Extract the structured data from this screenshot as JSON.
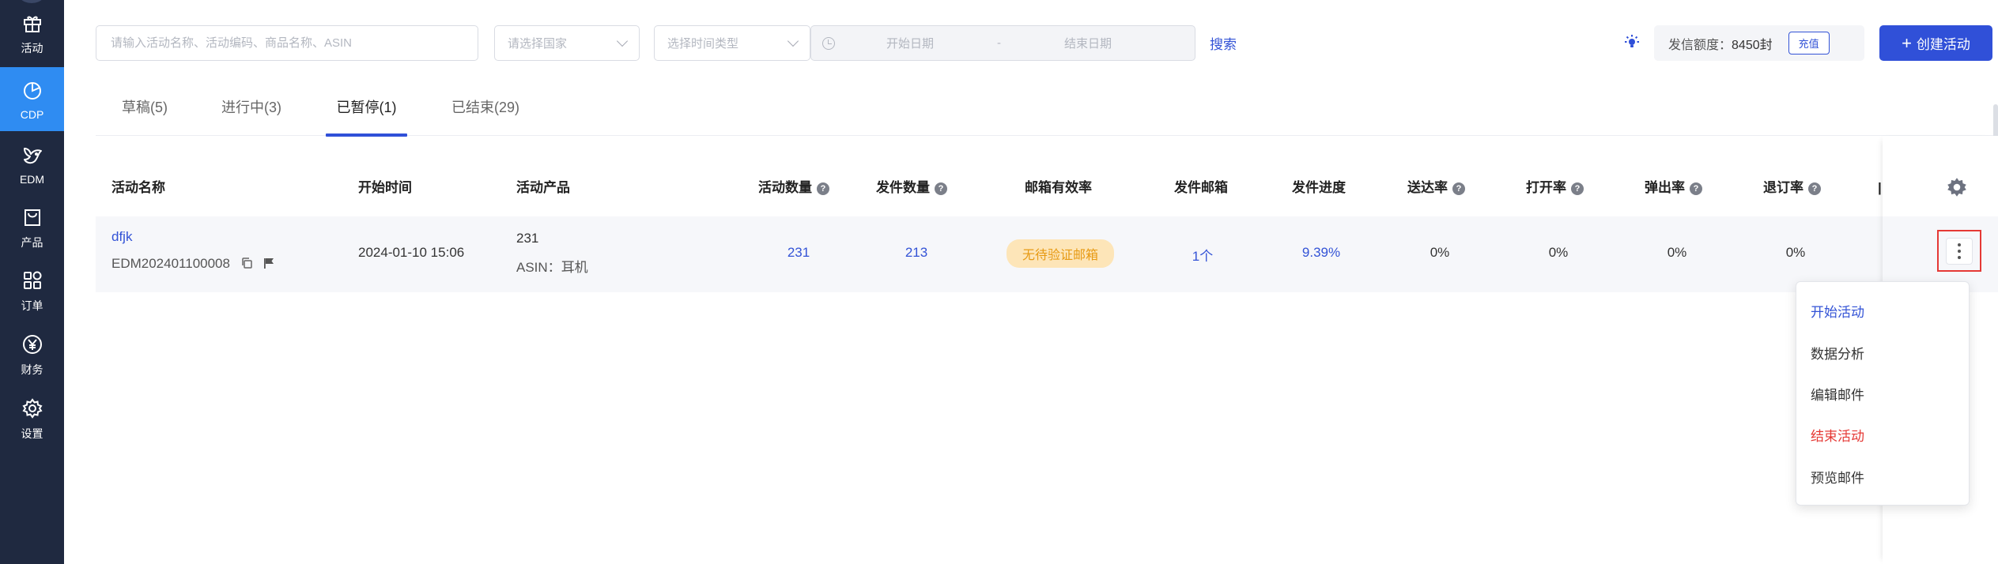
{
  "sidebar": {
    "items": [
      {
        "label": "活动",
        "icon": "gift-icon"
      },
      {
        "label": "CDP",
        "icon": "pie-chart-icon",
        "active": true
      },
      {
        "label": "EDM",
        "icon": "edm-bird-icon"
      },
      {
        "label": "产品",
        "icon": "shopping-bag-icon"
      },
      {
        "label": "订单",
        "icon": "grid-icon"
      },
      {
        "label": "财务",
        "icon": "yen-icon"
      },
      {
        "label": "设置",
        "icon": "gear-icon"
      }
    ]
  },
  "filters": {
    "search_placeholder": "请输入活动名称、活动编码、商品名称、ASIN",
    "country_placeholder": "请选择国家",
    "time_type_placeholder": "选择时间类型",
    "start_date_placeholder": "开始日期",
    "date_separator": "-",
    "end_date_placeholder": "结束日期",
    "search_label": "搜索"
  },
  "quota": {
    "label": "发信额度：",
    "value": "8450封",
    "recharge_label": "充值"
  },
  "create_button": {
    "icon": "+",
    "label": "创建活动"
  },
  "tabs": [
    {
      "label": "草稿(5)"
    },
    {
      "label": "进行中(3)"
    },
    {
      "label": "已暂停(1)",
      "active": true
    },
    {
      "label": "已结束(29)"
    }
  ],
  "table": {
    "columns": {
      "name": "活动名称",
      "start_time": "开始时间",
      "product": "活动产品",
      "activity_count": "活动数量",
      "send_count": "发件数量",
      "mailbox_validity": "邮箱有效率",
      "sender_mailbox": "发件邮箱",
      "send_progress": "发件进度",
      "delivery_rate": "送达率",
      "open_rate": "打开率",
      "bounce_rate": "弹出率",
      "unsubscribe_rate": "退订率",
      "help_glyph": "?"
    },
    "rows": [
      {
        "name": "dfjk",
        "code": "EDM202401100008",
        "start_time": "2024-01-10 15:06",
        "product_id": "231",
        "asin_label": "ASIN：",
        "asin_value": "耳机",
        "activity_count": "231",
        "send_count": "213",
        "mailbox_validity": "无待验证邮箱",
        "sender_mailbox": "1个",
        "send_progress": "9.39%",
        "delivery_rate": "0%",
        "open_rate": "0%",
        "bounce_rate": "0%",
        "unsubscribe_rate": "0%"
      }
    ]
  },
  "row_menu": {
    "items": [
      {
        "label": "开始活动"
      },
      {
        "label": "数据分析"
      },
      {
        "label": "编辑邮件"
      },
      {
        "label": "结束活动"
      },
      {
        "label": "预览邮件"
      }
    ]
  },
  "colors": {
    "sidebar_bg": "#1f2940",
    "sidebar_active": "#2f8cf2",
    "primary": "#3050d8",
    "link": "#3353d6",
    "badge_bg": "#fde5b8",
    "badge_text": "#e79a14",
    "danger": "#e53935"
  }
}
